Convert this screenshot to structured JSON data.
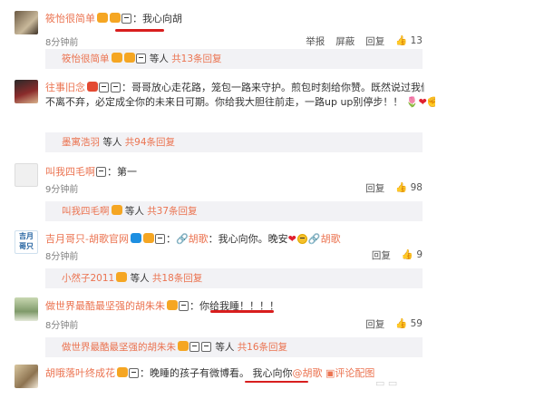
{
  "comments": [
    {
      "name": "筱怡很简单",
      "text": "我心向胡",
      "time": "8分钟前",
      "actions": [
        "举报",
        "屏蔽",
        "回复",
        "13"
      ],
      "reply_name": "筱怡很简单",
      "reply_mid": "等人",
      "reply_count": "共13条回复"
    },
    {
      "name": "往事旧念",
      "text_l1": "哥哥放心走花路，笼包一路来守护。煎包时刻给你赞。既然说过我们",
      "text_l2": "不离不弃，必定成全你的未来日可期。你给我大胆往前走，一路up up别停步！！",
      "reply_name": "墨寓浩羽",
      "reply_mid": "等人",
      "reply_count": "共94条回复"
    },
    {
      "name": "叫我四毛啊",
      "text": "第一",
      "time": "9分钟前",
      "actions": [
        "回复",
        "98"
      ],
      "reply_name": "叫我四毛啊",
      "reply_mid": "等人",
      "reply_count": "共37条回复"
    },
    {
      "name": "吉月哥只-胡歌官网",
      "mention": "胡歌",
      "text": "我心向你。晚安",
      "mention2": "胡歌",
      "time": "8分钟前",
      "actions": [
        "回复",
        "9"
      ],
      "reply_name": "小然子2011",
      "reply_mid": "等人",
      "reply_count": "共18条回复"
    },
    {
      "name": "做世界最酷最坚强的胡朱朱",
      "text": "你给我睡！！！！",
      "time": "8分钟前",
      "actions": [
        "回复",
        "59"
      ],
      "reply_name": "做世界最酷最坚强的胡朱朱",
      "reply_mid": "等人",
      "reply_count": "共16条回复"
    },
    {
      "name": "胡哦落叶终成花",
      "text_a": "晚睡的孩子有微博看。",
      "text_b": "我心向你",
      "mention": "@胡歌",
      "link": "评论配图"
    }
  ],
  "colors": {
    "name": "#eb7350",
    "underline": "#d81e1e",
    "reply_bg": "#f2f2f5"
  }
}
